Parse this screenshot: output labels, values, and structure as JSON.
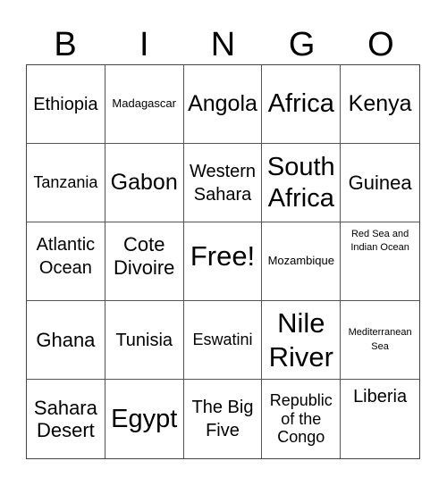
{
  "header": {
    "letters": [
      "B",
      "I",
      "N",
      "G",
      "O"
    ]
  },
  "cells": [
    "Ethiopia",
    "Madagascar",
    "Angola",
    "Africa",
    "Kenya",
    "Tanzania",
    "Gabon",
    "Western Sahara",
    "South Africa",
    "Guinea",
    "Atlantic Ocean",
    "Cote Divoire",
    "Free!",
    "Mozambique",
    "Red Sea and Indian Ocean",
    "Ghana",
    "Tunisia",
    "Eswatini",
    "Nile River",
    "Mediterranean Sea",
    "Sahara Desert",
    "Egypt",
    "The Big Five",
    "Republic of the Congo",
    "Liberia"
  ]
}
